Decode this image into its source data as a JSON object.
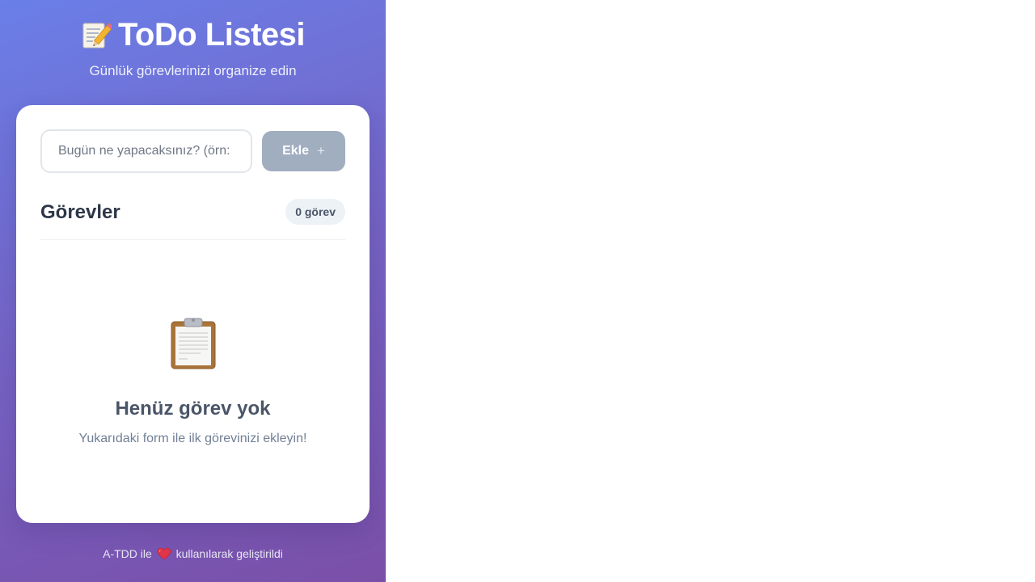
{
  "header": {
    "icon": "memo-icon",
    "title": "ToDo Listesi",
    "subtitle": "Günlük görevlerinizi organize edin"
  },
  "form": {
    "input_placeholder": "Bugün ne yapacaksınız? (örn:",
    "input_value": "",
    "add_button_label": "Ekle",
    "add_button_icon": "plus-icon",
    "add_button_color": "#a0aec0"
  },
  "tasks": {
    "section_title": "Görevler",
    "count_label": "0 görev",
    "items": []
  },
  "empty_state": {
    "icon": "clipboard-icon",
    "title": "Henüz görev yok",
    "text": "Yukarıdaki form ile ilk görevinizi ekleyin!"
  },
  "footer": {
    "text_before": "A-TDD ile",
    "icon": "heart-icon",
    "text_after": "kullanılarak geliştirildi"
  },
  "colors": {
    "gradient_start": "#6a7fe8",
    "gradient_end": "#7a4fa8",
    "heading": "#2d3748",
    "badge_bg": "#edf2f7"
  }
}
